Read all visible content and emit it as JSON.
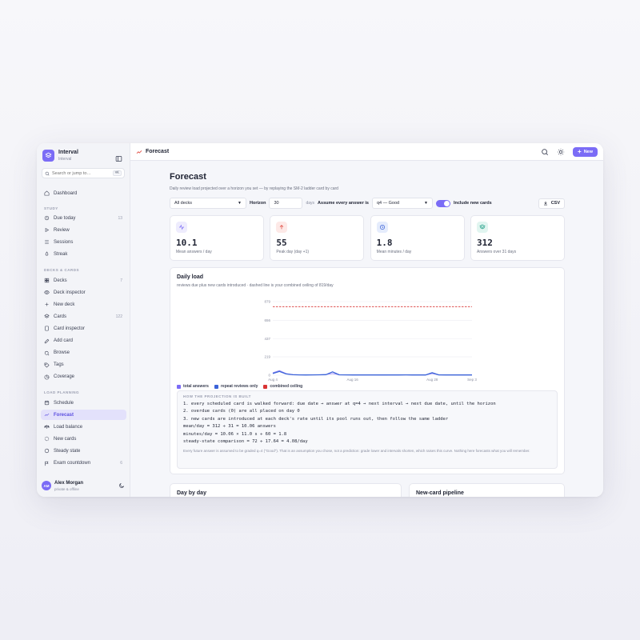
{
  "app": {
    "name": "Interval",
    "subtitle": "Interval"
  },
  "sidebar": {
    "search_placeholder": "Search or jump to…",
    "search_shortcut": "⌘K",
    "dashboard": "Dashboard",
    "sections": {
      "study": "STUDY",
      "decks": "DECKS & CARDS",
      "load": "LOAD PLANNING"
    },
    "study_items": [
      {
        "label": "Due today",
        "count": "13"
      },
      {
        "label": "Review",
        "count": ""
      },
      {
        "label": "Sessions",
        "count": ""
      },
      {
        "label": "Streak",
        "count": ""
      }
    ],
    "deck_items": [
      {
        "label": "Decks",
        "count": "7"
      },
      {
        "label": "Deck inspector",
        "count": ""
      },
      {
        "label": "New deck",
        "count": ""
      },
      {
        "label": "Cards",
        "count": "122"
      },
      {
        "label": "Card inspector",
        "count": ""
      },
      {
        "label": "Add card",
        "count": ""
      },
      {
        "label": "Browse",
        "count": ""
      },
      {
        "label": "Tags",
        "count": ""
      },
      {
        "label": "Coverage",
        "count": ""
      }
    ],
    "load_items": [
      {
        "label": "Schedule",
        "count": ""
      },
      {
        "label": "Forecast",
        "count": "",
        "active": true
      },
      {
        "label": "Load balance",
        "count": ""
      },
      {
        "label": "New cards",
        "count": ""
      },
      {
        "label": "Steady state",
        "count": ""
      },
      {
        "label": "Exam countdown",
        "count": "6"
      }
    ],
    "user": {
      "initials": "AM",
      "name": "Alex Morgan",
      "status": "private & offline"
    }
  },
  "topbar": {
    "title": "Forecast",
    "new_label": "New"
  },
  "page": {
    "title": "Forecast",
    "subtitle": "Daily review load projected over a horizon you set — by replaying the SM-2 ladder card by card"
  },
  "controls": {
    "deck_select": "All decks",
    "horizon_label": "Horizon",
    "horizon_value": "30",
    "horizon_unit": "days",
    "assume_label": "Assume every answer is",
    "grade_select": "q4 — Good",
    "include_label": "Include new cards",
    "csv_label": "CSV"
  },
  "stats": [
    {
      "value": "10.1",
      "label": "Mean answers / day",
      "icon": "activity-icon",
      "color": "#7b6cf6",
      "bg": "#eeecfd"
    },
    {
      "value": "55",
      "label": "Peak day (day +1)",
      "icon": "arrow-up-icon",
      "color": "#e0483e",
      "bg": "#fde9e7"
    },
    {
      "value": "1.8",
      "label": "Mean minutes / day",
      "icon": "clock-icon",
      "color": "#3b63d8",
      "bg": "#e5ecfc"
    },
    {
      "value": "312",
      "label": "Answers over 31 days",
      "icon": "layers-icon",
      "color": "#1f9e86",
      "bg": "#e1f5f0"
    }
  ],
  "daily_load": {
    "title": "Daily load",
    "subtitle": "reviews due plus new cards introduced · dashed line is your combined ceiling of 819/day",
    "legend": [
      {
        "label": "total answers",
        "color": "#7b6cf6"
      },
      {
        "label": "repeat reviews only",
        "color": "#3b63d8"
      },
      {
        "label": "combined ceiling",
        "color": "#d93434"
      }
    ]
  },
  "chart_data": {
    "type": "line",
    "ylim": [
      0,
      879
    ],
    "y_ticks": [
      "879",
      "656",
      "437",
      "219",
      "0"
    ],
    "x_ticks": [
      "Aug 4",
      "Aug 16",
      "Aug 28",
      "Sep 3"
    ],
    "x": [
      "Aug 4",
      "Aug 5",
      "Aug 6",
      "Aug 7",
      "Aug 8",
      "Aug 9",
      "Aug 10",
      "Aug 11",
      "Aug 12",
      "Aug 13",
      "Aug 14",
      "Aug 15",
      "Aug 16",
      "Aug 17",
      "Aug 18",
      "Aug 19",
      "Aug 20",
      "Aug 21",
      "Aug 22",
      "Aug 23",
      "Aug 24",
      "Aug 25",
      "Aug 26",
      "Aug 27",
      "Aug 28",
      "Aug 29",
      "Aug 30",
      "Aug 31",
      "Sep 1",
      "Sep 2",
      "Sep 3"
    ],
    "ceiling": 819,
    "series": [
      {
        "name": "total answers",
        "values": [
          30,
          55,
          20,
          8,
          5,
          4,
          5,
          6,
          8,
          20,
          6,
          5,
          4,
          4,
          5,
          4,
          3,
          3,
          4,
          4,
          5,
          3,
          4,
          3,
          20,
          5,
          4,
          4,
          3,
          3,
          3
        ]
      },
      {
        "name": "repeat reviews only",
        "values": [
          20,
          45,
          15,
          6,
          4,
          3,
          4,
          5,
          7,
          40,
          5,
          4,
          3,
          3,
          4,
          3,
          3,
          3,
          3,
          3,
          4,
          3,
          3,
          3,
          30,
          4,
          3,
          3,
          3,
          3,
          3
        ]
      }
    ]
  },
  "projection": {
    "title": "HOW THE PROJECTION IS BUILT",
    "lines": [
      "1. every scheduled card is walked forward: due date → answer at q=4 → next interval → next due date, until the horizon",
      "2. overdue cards (0) are all placed on day 0",
      "3. new cards are introduced at each deck's rate until its pool runs out, then follow the same ladder",
      "mean/day = 312 ÷ 31 = 10.06 answers",
      "minutes/day = 10.06 × 11.0 s ÷ 60 = 1.8",
      "steady-state comparison = 72 ÷ 17.64 = 4.08/day"
    ],
    "note": "Every future answer is assumed to be graded q=4 (\"Good\"). That is an assumption you chose, not a prediction: grade lower and intervals shorten, which raises this curve. Nothing here forecasts what you will remember."
  },
  "bottom_cards": {
    "day_by_day": "Day by day",
    "pipeline": "New-card pipeline"
  }
}
